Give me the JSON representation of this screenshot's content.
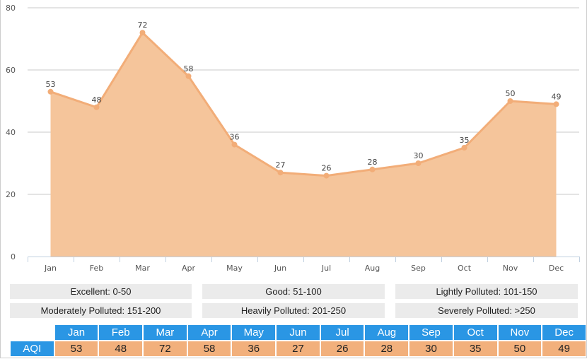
{
  "chart_data": {
    "type": "area",
    "title": "",
    "xlabel": "",
    "ylabel": "",
    "categories": [
      "Jan",
      "Feb",
      "Mar",
      "Apr",
      "May",
      "Jun",
      "Jul",
      "Aug",
      "Sep",
      "Oct",
      "Nov",
      "Dec"
    ],
    "series": [
      {
        "name": "AQI",
        "values": [
          53,
          48,
          72,
          58,
          36,
          27,
          26,
          28,
          30,
          35,
          50,
          49
        ]
      }
    ],
    "ylim": [
      0,
      80
    ],
    "yticks": [
      0,
      20,
      40,
      60,
      80
    ],
    "ytick_labels": [
      "0",
      "20",
      "40",
      "60",
      "80"
    ],
    "grid": true,
    "legend": "none",
    "data_labels": true,
    "colors": {
      "line": "#f2ad78",
      "fill": "#f5c59b",
      "grid": "#c8c8c8",
      "axis": "#c0d0e0"
    }
  },
  "legend_boxes": [
    {
      "label": "Excellent: 0-50"
    },
    {
      "label": "Good: 51-100"
    },
    {
      "label": "Lightly Polluted: 101-150"
    },
    {
      "label": "Moderately Polluted: 151-200"
    },
    {
      "label": "Heavily Polluted: 201-250"
    },
    {
      "label": "Severely Polluted: >250"
    }
  ],
  "table": {
    "row_label": "AQI",
    "months": [
      "Jan",
      "Feb",
      "Mar",
      "Apr",
      "May",
      "Jun",
      "Jul",
      "Aug",
      "Sep",
      "Oct",
      "Nov",
      "Dec"
    ],
    "values": [
      "53",
      "48",
      "72",
      "58",
      "36",
      "27",
      "26",
      "28",
      "30",
      "35",
      "50",
      "49"
    ],
    "header_color": "#2a96e4",
    "value_color": "#f2b07c"
  }
}
